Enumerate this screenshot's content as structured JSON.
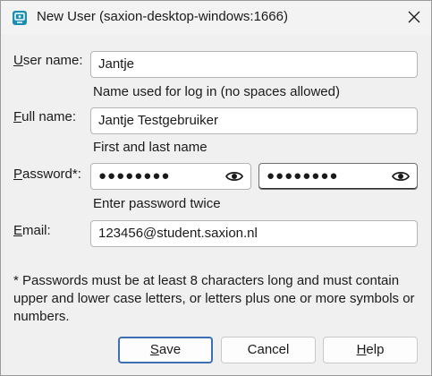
{
  "window": {
    "title": "New User (saxion-desktop-windows:1666)",
    "app_icon": "user-dialog-icon",
    "close_icon": "close-icon"
  },
  "form": {
    "username": {
      "label_access": "U",
      "label_rest": "ser name:",
      "value": "Jantje",
      "hint": "Name used for log in (no spaces allowed)"
    },
    "fullname": {
      "label_access": "F",
      "label_rest": "ull name:",
      "value": "Jantje Testgebruiker",
      "hint": "First and last name"
    },
    "password": {
      "label_access": "P",
      "label_rest": "assword*:",
      "value1": "●●●●●●●●",
      "value2": "●●●●●●●●",
      "reveal_icon": "eye-icon",
      "hint": "Enter password twice"
    },
    "email": {
      "label_access": "E",
      "label_rest": "mail:",
      "value": "123456@student.saxion.nl"
    },
    "note": "* Passwords must be at least 8 characters long and must contain upper and lower case letters, or letters plus one or more symbols or numbers."
  },
  "buttons": {
    "save_access": "S",
    "save_rest": "ave",
    "cancel": "Cancel",
    "help_access": "H",
    "help_rest": "elp"
  },
  "colors": {
    "accent": "#3d6fb6",
    "icon_teal": "#1a8fb0"
  }
}
